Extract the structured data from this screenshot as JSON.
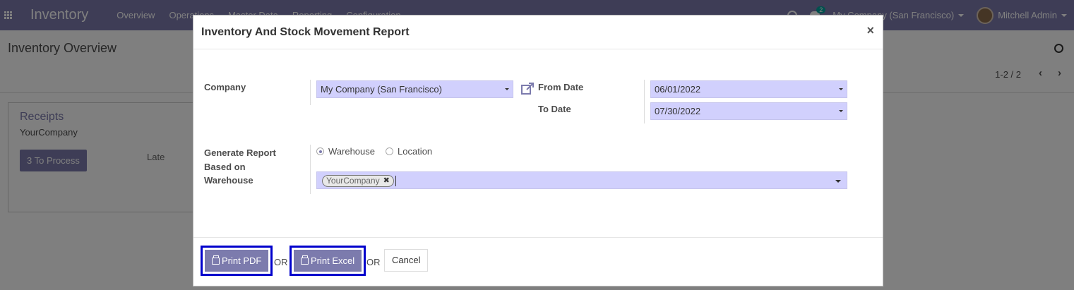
{
  "navbar": {
    "app_title": "Inventory",
    "menu": [
      "Overview",
      "Operations",
      "Master Data",
      "Reporting",
      "Configuration"
    ],
    "chat_count": "2",
    "company": "My Company (San Francisco)",
    "user": "Mitchell Admin"
  },
  "control_panel": {
    "breadcrumb": "Inventory Overview",
    "pager": "1-2 / 2"
  },
  "kanban": {
    "title": "Receipts",
    "company": "YourCompany",
    "process_button": "3 To Process",
    "late_label": "Late"
  },
  "modal": {
    "title": "Inventory And Stock Movement Report",
    "close": "×",
    "company_label": "Company",
    "company_value": "My Company (San Francisco)",
    "from_date_label": "From Date",
    "from_date_value": "06/01/2022",
    "to_date_label": "To Date",
    "to_date_value": "07/30/2022",
    "report_basis_label_1": "Generate Report",
    "report_basis_label_2": "Based on",
    "warehouse_label": "Warehouse",
    "radio_warehouse": "Warehouse",
    "radio_location": "Location",
    "selected_radio": "Warehouse",
    "warehouse_tag": "YourCompany",
    "print_pdf": "Print PDF",
    "or_1": "OR",
    "print_excel": "Print Excel",
    "or_2": "OR",
    "cancel": "Cancel"
  },
  "colors": {
    "brand": "#7c7bad",
    "field_bg": "#d1d0fd",
    "highlight_border": "#0000cc"
  }
}
